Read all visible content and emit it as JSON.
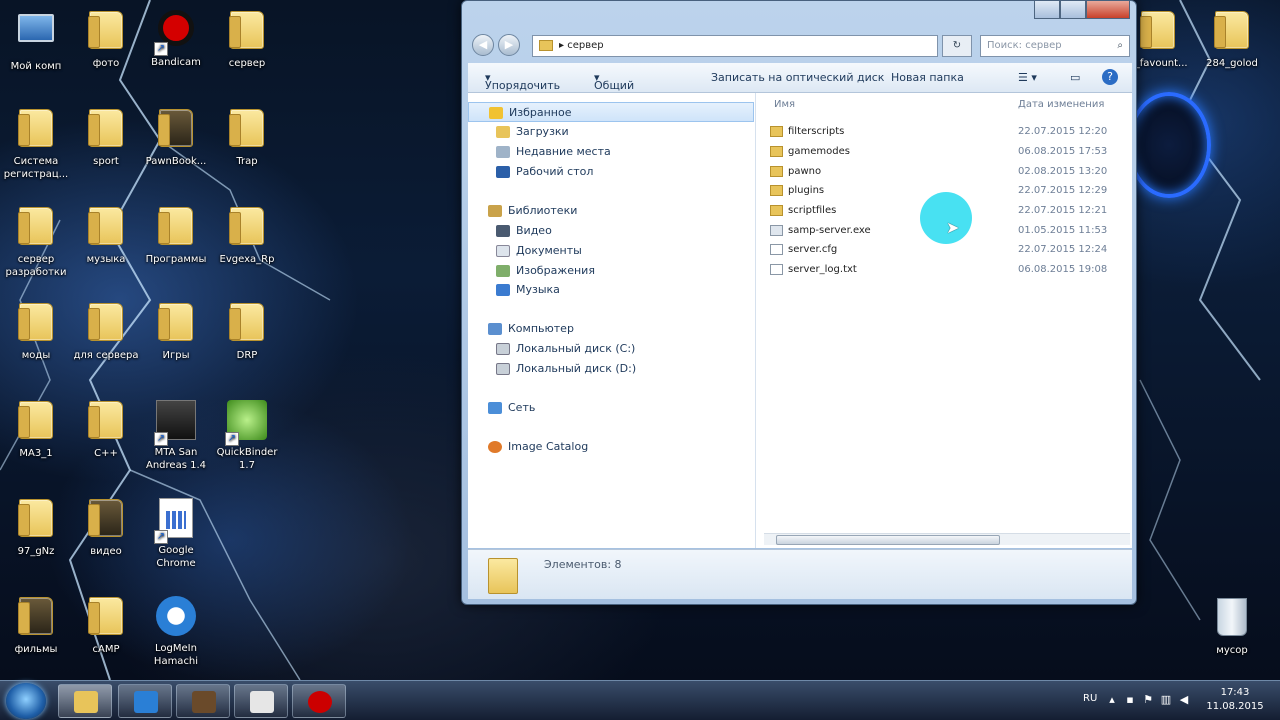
{
  "desktop": {
    "icons": [
      {
        "label": "Мой комп",
        "kind": "computer"
      },
      {
        "label": "фото",
        "kind": "folder"
      },
      {
        "label": "Bandicam",
        "kind": "bandicam"
      },
      {
        "label": "сервер",
        "kind": "folder"
      },
      {
        "label": "Система регистрац...",
        "kind": "folder"
      },
      {
        "label": "sport",
        "kind": "folder"
      },
      {
        "label": "PawnBook...",
        "kind": "folder"
      },
      {
        "label": "Trap",
        "kind": "folder"
      },
      {
        "label": "сервер разработки",
        "kind": "folder"
      },
      {
        "label": "музыка",
        "kind": "folder"
      },
      {
        "label": "Программы",
        "kind": "folder"
      },
      {
        "label": "Evgexa_Rp",
        "kind": "folder"
      },
      {
        "label": "моды",
        "kind": "folder"
      },
      {
        "label": "для сервера",
        "kind": "folder"
      },
      {
        "label": "Игры",
        "kind": "folder"
      },
      {
        "label": "DRP",
        "kind": "folder"
      },
      {
        "label": "MA3_1",
        "kind": "folder"
      },
      {
        "label": "C++",
        "kind": "folder"
      },
      {
        "label": "MTA San Andreas 1.4",
        "kind": "mta"
      },
      {
        "label": "QuickBinder 1.7",
        "kind": "quickbinder"
      },
      {
        "label": "97_gNz",
        "kind": "folder"
      },
      {
        "label": "видео",
        "kind": "folder"
      },
      {
        "label": "Google Chrome",
        "kind": "chrome"
      },
      {
        "label": "фильмы",
        "kind": "folder"
      },
      {
        "label": "cAMP",
        "kind": "folder"
      },
      {
        "label": "LogMeIn Hamachi",
        "kind": "hamachi"
      },
      {
        "label": "7_favount...",
        "kind": "folder"
      },
      {
        "label": "284_golod",
        "kind": "folder"
      },
      {
        "label": "мусор",
        "kind": "trash"
      }
    ]
  },
  "explorer": {
    "address": "сервер",
    "search_placeholder": "Поиск: сервер",
    "toolbar": {
      "organize": "Упорядочить",
      "share": "Общий доступ",
      "burn": "Записать на оптический диск",
      "new_folder": "Новая папка"
    },
    "nav": {
      "favorites": "Избранное",
      "downloads": "Загрузки",
      "recent": "Недавние места",
      "desktop": "Рабочий стол",
      "libraries": "Библиотеки",
      "video": "Видео",
      "documents": "Документы",
      "images": "Изображения",
      "music": "Музыка",
      "computer": "Компьютер",
      "disk_c": "Локальный диск (C:)",
      "disk_d": "Локальный диск (D:)",
      "network": "Сеть",
      "image_catalog": "Image Catalog"
    },
    "columns": {
      "name": "Имя",
      "date": "Дата изменения"
    },
    "files": [
      {
        "name": "filterscripts",
        "date": "22.07.2015 12:20",
        "type": "folder"
      },
      {
        "name": "gamemodes",
        "date": "06.08.2015 17:53",
        "type": "folder"
      },
      {
        "name": "pawno",
        "date": "02.08.2015 13:20",
        "type": "folder"
      },
      {
        "name": "plugins",
        "date": "22.07.2015 12:29",
        "type": "folder"
      },
      {
        "name": "scriptfiles",
        "date": "22.07.2015 12:21",
        "type": "folder"
      },
      {
        "name": "samp-server.exe",
        "date": "01.05.2015 11:53",
        "type": "exe"
      },
      {
        "name": "server.cfg",
        "date": "22.07.2015 12:24",
        "type": "file"
      },
      {
        "name": "server_log.txt",
        "date": "06.08.2015 19:08",
        "type": "file"
      }
    ],
    "status": "Элементов: 8"
  },
  "taskbar": {
    "lang": "RU",
    "time": "17:43",
    "date": "11.08.2015"
  }
}
